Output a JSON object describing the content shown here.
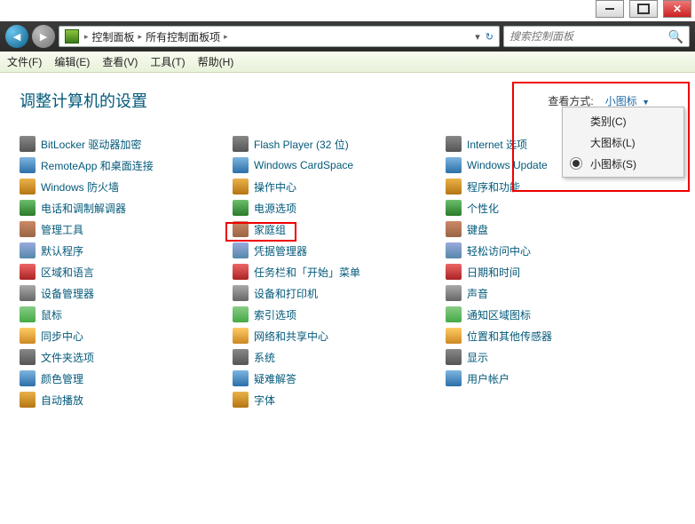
{
  "titlebar": {
    "min": "min",
    "max": "max",
    "close": "close"
  },
  "breadcrumb": {
    "root": "控制面板",
    "current": "所有控制面板项"
  },
  "search": {
    "placeholder": "搜索控制面板"
  },
  "menu": {
    "file": "文件(F)",
    "edit": "编辑(E)",
    "view": "查看(V)",
    "tools": "工具(T)",
    "help": "帮助(H)"
  },
  "heading": "调整计算机的设置",
  "view_label": "查看方式:",
  "view_value": "小图标",
  "dropdown": {
    "category": "类别(C)",
    "large": "大图标(L)",
    "small": "小图标(S)"
  },
  "col1": [
    "BitLocker 驱动器加密",
    "RemoteApp 和桌面连接",
    "Windows 防火墙",
    "电话和调制解调器",
    "管理工具",
    "默认程序",
    "区域和语言",
    "设备管理器",
    "鼠标",
    "同步中心",
    "文件夹选项",
    "颜色管理",
    "自动播放"
  ],
  "col2": [
    "Flash Player (32 位)",
    "Windows CardSpace",
    "操作中心",
    "电源选项",
    "家庭组",
    "凭据管理器",
    "任务栏和「开始」菜单",
    "设备和打印机",
    "索引选项",
    "网络和共享中心",
    "系统",
    "疑难解答",
    "字体"
  ],
  "col3": [
    "Internet 选项",
    "Windows Update",
    "程序和功能",
    "个性化",
    "键盘",
    "轻松访问中心",
    "日期和时间",
    "声音",
    "通知区域图标",
    "位置和其他传感器",
    "显示",
    "用户帐户"
  ]
}
